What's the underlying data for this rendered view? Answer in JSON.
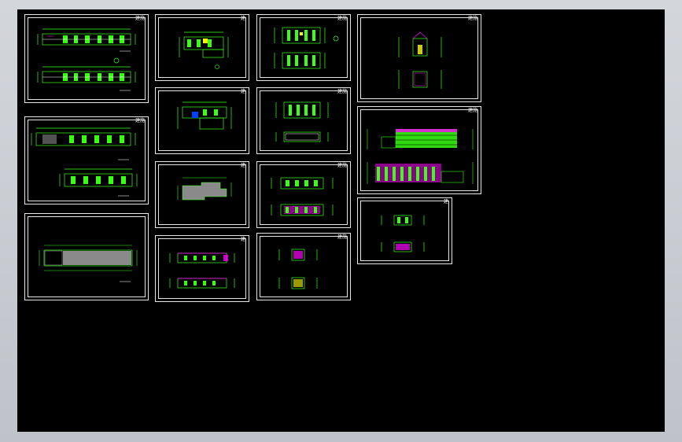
{
  "viewport": {
    "background": "#000000",
    "frame_color": "#c9ccd2"
  },
  "colors": {
    "plan_line": "#39ff14",
    "wall": "#ffffff",
    "dim": "#39ff14",
    "accent_magenta": "#ff00ff",
    "accent_yellow": "#ffff00",
    "accent_blue": "#0040ff",
    "hatch_grey": "#8a8a8a",
    "border": "#e6e6e6"
  },
  "sheets": [
    {
      "id": "s1",
      "kind": "plan-double",
      "tag": "建施"
    },
    {
      "id": "s2",
      "kind": "plan-double-offset",
      "tag": "建施"
    },
    {
      "id": "s3",
      "kind": "roof-plan",
      "tag": ""
    },
    {
      "id": "s4",
      "kind": "small-plan",
      "tag": "建"
    },
    {
      "id": "s5",
      "kind": "small-plan-blue",
      "tag": "建"
    },
    {
      "id": "s6",
      "kind": "outline-plan",
      "tag": "建"
    },
    {
      "id": "s7",
      "kind": "elevation-pair",
      "tag": "建"
    },
    {
      "id": "s8",
      "kind": "elev-plan-pair",
      "tag": "建施"
    },
    {
      "id": "s9",
      "kind": "elev-plan-pair-2",
      "tag": "建施"
    },
    {
      "id": "s10",
      "kind": "elevation-pair-2",
      "tag": "建施"
    },
    {
      "id": "s11",
      "kind": "section-pair",
      "tag": "建施"
    },
    {
      "id": "s12",
      "kind": "side-elevations",
      "tag": "建施"
    },
    {
      "id": "s13",
      "kind": "main-elevations",
      "tag": "建施"
    },
    {
      "id": "s14",
      "kind": "detail-pair",
      "tag": "建"
    }
  ]
}
